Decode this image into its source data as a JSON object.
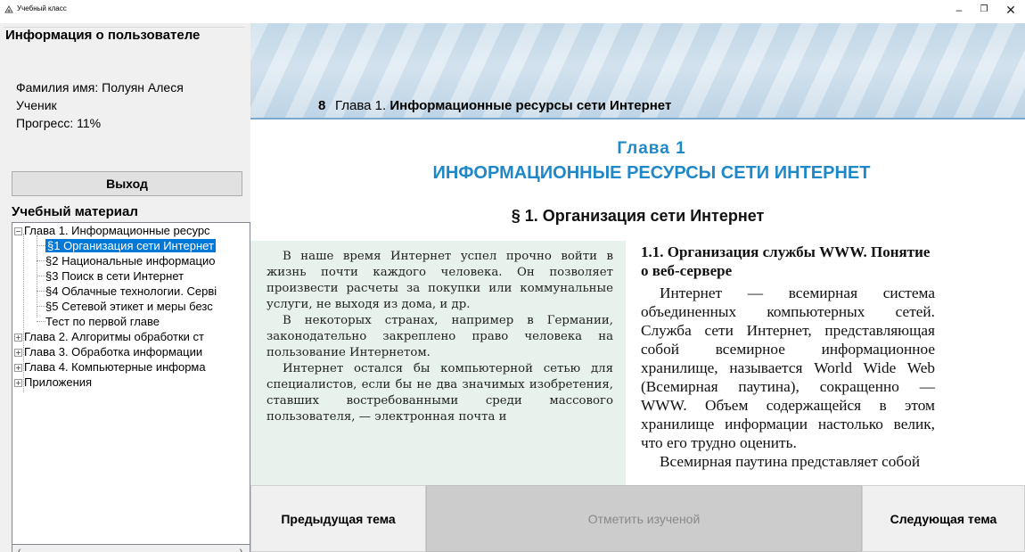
{
  "window": {
    "title": "Учебный класс",
    "minimize_glyph": "–",
    "maximize_glyph": "❐",
    "close_glyph": "✕"
  },
  "user_info": {
    "heading": "Информация о пользователе",
    "name_line": "Фамилия имя: Полуян Алеся",
    "role": "Ученик",
    "progress_line": "Прогресс: 11%",
    "progress_value": 11,
    "logout_label": "Выход"
  },
  "material": {
    "heading": "Учебный материал",
    "tree": [
      {
        "label": "Глава 1. Информационные ресурс",
        "level": 0,
        "expander": "−"
      },
      {
        "label": "§1 Организация сети Интернет",
        "level": 1,
        "selected": true
      },
      {
        "label": "§2 Национальные информацио",
        "level": 1
      },
      {
        "label": "§3 Поиск в сети Интернет",
        "level": 1
      },
      {
        "label": "§4 Облачные технологии. Серві",
        "level": 1
      },
      {
        "label": "§5 Сетевой этикет и меры безс",
        "level": 1
      },
      {
        "label": "Тест по первой главе",
        "level": 1
      },
      {
        "label": "Глава 2. Алгоритмы обработки ст",
        "level": 0,
        "expander": "+"
      },
      {
        "label": "Глава 3. Обработка информации",
        "level": 0,
        "expander": "+"
      },
      {
        "label": "Глава 4. Компьютерные информа",
        "level": 0,
        "expander": "+"
      },
      {
        "label": "Приложения",
        "level": 0,
        "expander": "+"
      }
    ],
    "scroll_left": "‹",
    "scroll_right": "›"
  },
  "page": {
    "page_number": "8",
    "chapter_prefix": "Глава 1.",
    "chapter_title": "Информационные ресурсы сети Интернет",
    "chapter_heading": "Глава 1",
    "chapter_subheading": "ИНФОРМАЦИОННЫЕ РЕСУРСЫ СЕТИ ИНТЕРНЕТ",
    "section_title": "§ 1. Организация сети Интернет",
    "left_column": [
      "В наше время Интернет успел прочно войти в жизнь почти каждого человека. Он позволяет произвести расчеты за покупки или коммунальные услуги, не выходя из дома, и др.",
      "В некоторых странах, например в Германии, законодательно закреплено право человека на пользование Интернетом.",
      "Интернет остался бы компьютерной сетью для специалистов, если бы не два значимых изобретения, ставших востребованными среди массового пользователя, — электронная почта и"
    ],
    "right_heading": "1.1. Организация службы WWW. Понятие о веб-сервере",
    "right_column": [
      "Интернет — всемирная система объединенных компьютерных сетей. Служба сети Интернет, представляющая собой всемирное информационное хранилище, называется World Wide Web (Всемирная паутина), сокращенно — WWW. Объем содержащейся в этом хранилище информации настолько велик, что его трудно оценить.",
      "Всемирная паутина представляет собой"
    ]
  },
  "buttons": {
    "prev_label": "Предыдущая тема",
    "mark_label": "Отметить изученой",
    "next_label": "Следующая тема"
  },
  "colors": {
    "selection": "#0078d7",
    "heading_blue": "#1e88c8",
    "sidebar_note_bg": "#e8f2ec"
  }
}
